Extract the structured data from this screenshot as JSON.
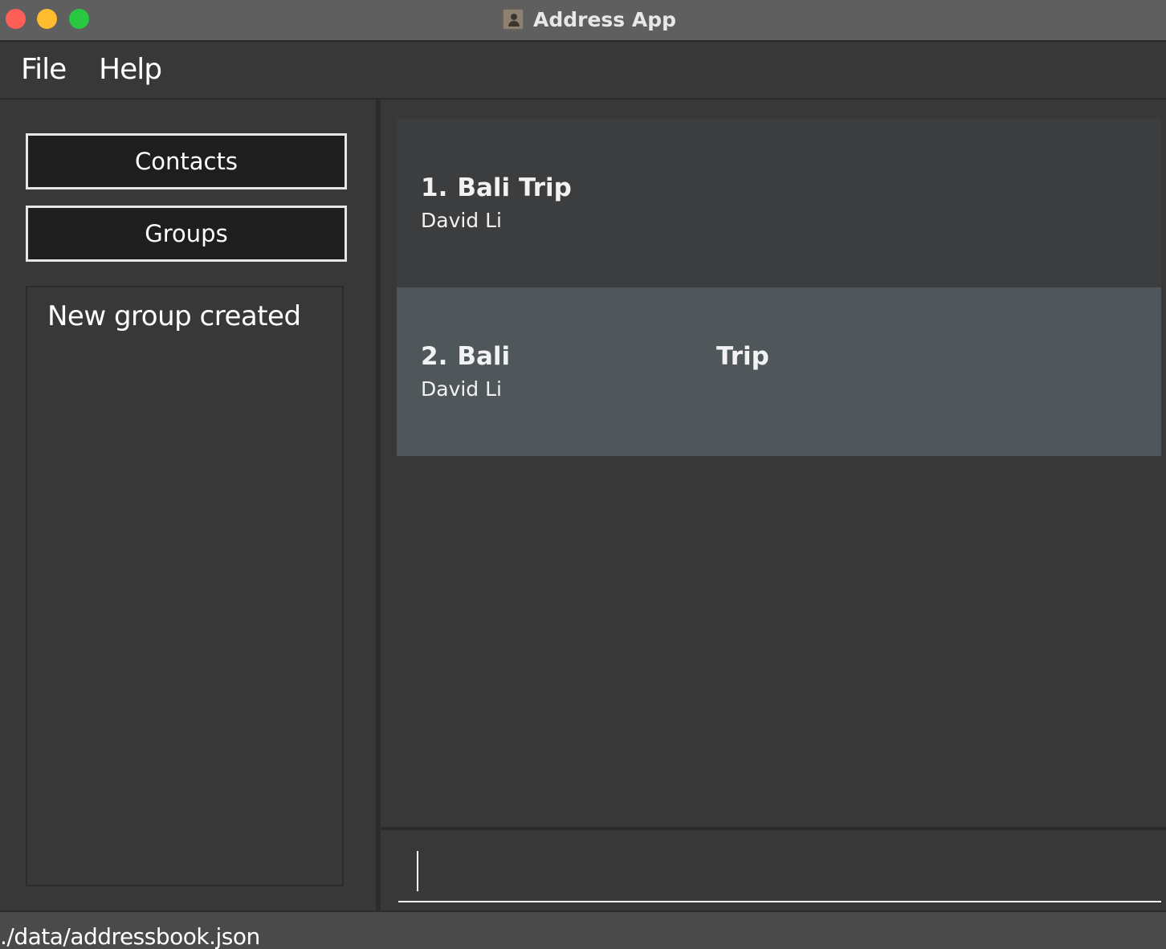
{
  "window": {
    "title": "Address App",
    "app_icon": "address-book-icon"
  },
  "menu": {
    "file_label": "File",
    "help_label": "Help"
  },
  "sidebar": {
    "contacts_label": "Contacts",
    "groups_label": "Groups",
    "result_message": "New group created"
  },
  "groups": [
    {
      "index": "1.",
      "name_part1": "Bali Trip",
      "name_part2": "",
      "member": "David Li",
      "selected": false
    },
    {
      "index": "2.",
      "name_part1": "Bali",
      "name_part2": "Trip",
      "member": "David Li",
      "selected": true
    }
  ],
  "command": {
    "value": "",
    "placeholder": ""
  },
  "status": {
    "file_path": "./data/addressbook.json"
  },
  "colors": {
    "close": "#ff5f57",
    "minimize": "#febc2e",
    "maximize": "#28c840",
    "background": "#383838",
    "card_odd": "#3c3d3f",
    "card_selected": "#50575b"
  }
}
